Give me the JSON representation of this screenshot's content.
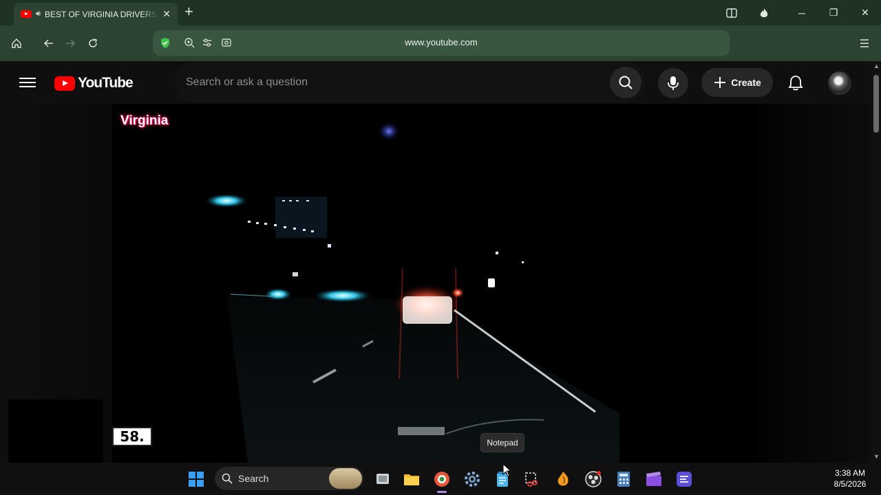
{
  "browser": {
    "tab_title": "BEST OF VIRGINIA DRIVERS",
    "url": "www.youtube.com"
  },
  "youtube": {
    "logo_text": "YouTube",
    "search_placeholder": "Search or ask a question",
    "create_label": "Create"
  },
  "video": {
    "overlay_label": "Virginia",
    "counter": "58."
  },
  "tooltip": "Notepad",
  "taskbar": {
    "search_label": "Search",
    "time": "3:38 AM",
    "date": "8/5/2026"
  }
}
